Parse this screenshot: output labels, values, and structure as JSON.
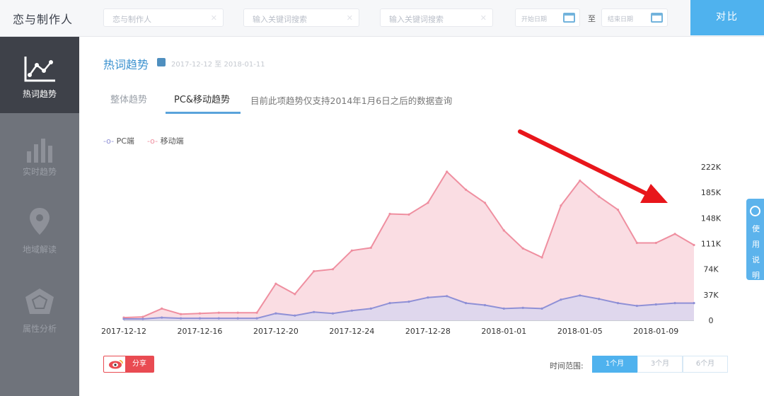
{
  "topbar": {
    "brand": "恋与制作人",
    "input1_placeholder": "恋与制作人",
    "input2_placeholder": "输入关键词搜索",
    "input3_placeholder": "输入关键词搜索",
    "date_start_placeholder": "开始日期",
    "date_end_placeholder": "结束日期",
    "to_label": "至",
    "compare_label": "对比"
  },
  "sidebar": {
    "items": [
      {
        "label": "热词趋势",
        "icon": "line-chart-icon"
      },
      {
        "label": "实时趋势",
        "icon": "bar-chart-icon"
      },
      {
        "label": "地域解读",
        "icon": "map-pin-icon"
      },
      {
        "label": "属性分析",
        "icon": "radar-icon"
      }
    ]
  },
  "panel": {
    "title": "热词趋势",
    "meta": "2017-12-12 至 2018-01-11",
    "tabs": [
      "整体趋势",
      "PC&移动趋势"
    ],
    "note": "目前此项趋势仅支持2014年1月6日之后的数据查询"
  },
  "footer": {
    "weibo_label": "分享",
    "range_label": "时间范围:",
    "range_options": [
      "1个月",
      "3个月",
      "6个月"
    ]
  },
  "float_tab": {
    "label": "使用说明"
  },
  "colors": {
    "pc": "#8f90d6",
    "mobile": "#ef8fa0",
    "mobile_fill": "#fadde3",
    "pc_fill": "#d9d6ef",
    "accent": "#4fb2ee",
    "arrow": "#e8161b"
  },
  "chart_data": {
    "type": "area",
    "legend_placement": "top-left",
    "y_axis_position": "right",
    "grid": false,
    "ylim": [
      0,
      222000
    ],
    "y_tick_labels": [
      "222K",
      "185K",
      "148K",
      "111K",
      "74K",
      "37K",
      "0"
    ],
    "y_tick_values": [
      222000,
      185000,
      148000,
      111000,
      74000,
      37000,
      0
    ],
    "x_tick_labels": [
      "2017-12-12",
      "2017-12-16",
      "2017-12-20",
      "2017-12-24",
      "2017-12-28",
      "2018-01-01",
      "2018-01-05",
      "2018-01-09"
    ],
    "x": [
      "2017-12-12",
      "2017-12-13",
      "2017-12-14",
      "2017-12-15",
      "2017-12-16",
      "2017-12-17",
      "2017-12-18",
      "2017-12-19",
      "2017-12-20",
      "2017-12-21",
      "2017-12-22",
      "2017-12-23",
      "2017-12-24",
      "2017-12-25",
      "2017-12-26",
      "2017-12-27",
      "2017-12-28",
      "2017-12-29",
      "2017-12-30",
      "2017-12-31",
      "2018-01-01",
      "2018-01-02",
      "2018-01-03",
      "2018-01-04",
      "2018-01-05",
      "2018-01-06",
      "2018-01-07",
      "2018-01-08",
      "2018-01-09",
      "2018-01-10",
      "2018-01-11"
    ],
    "series": [
      {
        "name": "PC端",
        "values": [
          2000,
          2000,
          4000,
          3000,
          3000,
          3000,
          3000,
          3000,
          10000,
          7000,
          12000,
          10000,
          14000,
          17000,
          25000,
          27000,
          33000,
          35000,
          25000,
          22000,
          17000,
          18000,
          17000,
          30000,
          36000,
          31000,
          25000,
          21000,
          23000,
          25000,
          25000
        ]
      },
      {
        "name": "移动端",
        "values": [
          4000,
          5000,
          17000,
          9000,
          10000,
          11000,
          11000,
          11000,
          53000,
          38000,
          71000,
          74000,
          101000,
          105000,
          154000,
          153000,
          170000,
          215000,
          189000,
          170000,
          130000,
          104000,
          91000,
          166000,
          202000,
          179000,
          160000,
          112000,
          112000,
          125000,
          109000
        ]
      }
    ]
  }
}
